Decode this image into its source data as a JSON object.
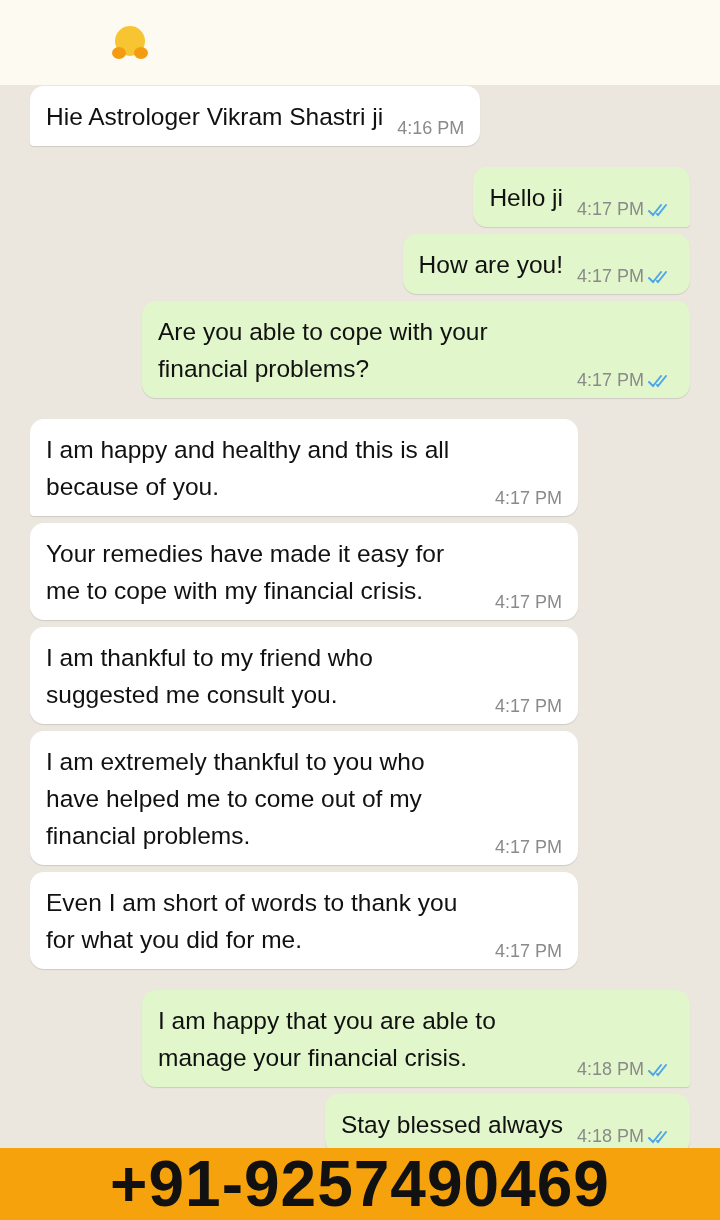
{
  "header": {
    "kind": "emoji"
  },
  "messages": [
    {
      "kind": "incoming",
      "text": "Hie Astrologer Vikram Shastri ji",
      "time": "4:16 PM",
      "tail": true
    },
    {
      "kind": "outgoing",
      "text": "Hello ji",
      "time": "4:17 PM",
      "read": true,
      "tail": true
    },
    {
      "kind": "outgoing",
      "text": "How are you!",
      "time": "4:17 PM",
      "read": true,
      "tail": false
    },
    {
      "kind": "outgoing",
      "text": "Are you able to cope with your financial problems?",
      "time": "4:17 PM",
      "read": true,
      "tail": false
    },
    {
      "kind": "incoming",
      "text": "I am happy and healthy and this is all because of you.",
      "time": "4:17 PM",
      "tail": true
    },
    {
      "kind": "incoming",
      "text": "Your remedies have made it easy for me to cope with my financial crisis.",
      "time": "4:17 PM",
      "tail": false
    },
    {
      "kind": "incoming",
      "text": "I am thankful to my friend who suggested me consult you.",
      "time": "4:17 PM",
      "tail": false
    },
    {
      "kind": "incoming",
      "text": "I am extremely thankful to you who have helped me to come out of my financial problems.",
      "time": "4:17 PM",
      "tail": false
    },
    {
      "kind": "incoming",
      "text": "Even I am short of words to thank you for what you did for me.",
      "time": "4:17 PM",
      "tail": false
    },
    {
      "kind": "outgoing",
      "text": "I am happy that you are able to manage your financial crisis.",
      "time": "4:18 PM",
      "read": true,
      "tail": true
    },
    {
      "kind": "outgoing",
      "text": "Stay blessed always",
      "time": "4:18 PM",
      "read": true,
      "tail": false
    }
  ],
  "banner": {
    "phone": "+91-9257490469"
  }
}
